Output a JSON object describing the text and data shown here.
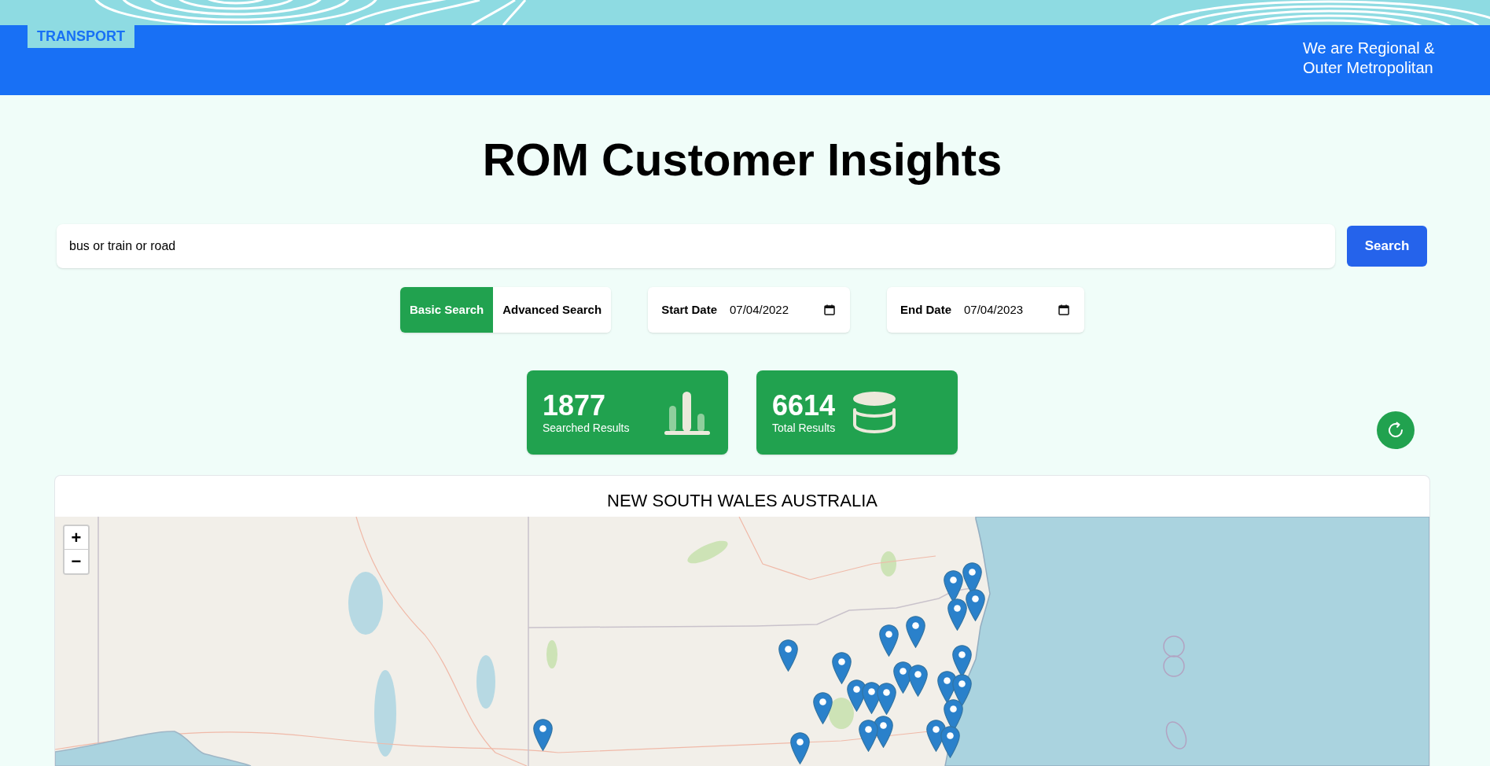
{
  "banner": {
    "brand": "TRANSPORT",
    "tagline": "We are Regional & Outer Metropolitan"
  },
  "title": "ROM Customer Insights",
  "search": {
    "value": "bus or train or road",
    "button": "Search"
  },
  "search_modes": [
    {
      "label": "Basic Search",
      "selected": true
    },
    {
      "label": "Advanced Search",
      "selected": false
    }
  ],
  "date_filters": [
    {
      "label": "Start Date",
      "value": "07/04/2022"
    },
    {
      "label": "End Date",
      "value": "07/04/2023"
    }
  ],
  "stats": [
    {
      "kind": "bars",
      "value": "1877",
      "label": "Searched Results"
    },
    {
      "kind": "stack",
      "value": "6614",
      "label": "Total Results"
    }
  ],
  "map": {
    "title": "NEW SOUTH WALES AUSTRALIA",
    "zoom_controls": [
      "+",
      "−"
    ]
  }
}
